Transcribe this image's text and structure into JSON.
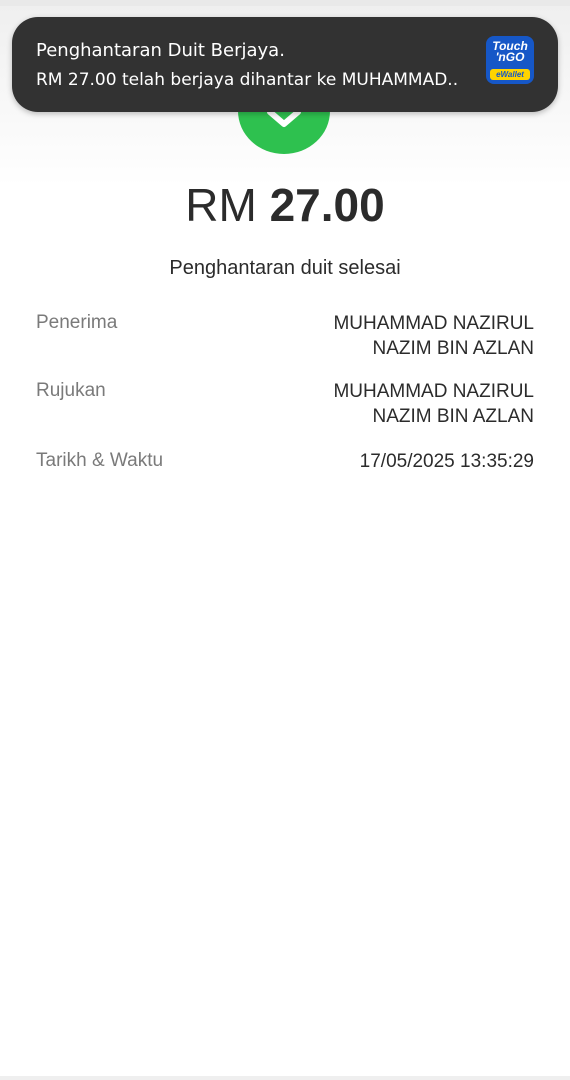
{
  "notification": {
    "title": "Penghantaran Duit Berjaya.",
    "body": "RM 27.00 telah berjaya dihantar ke MUHAMMAD..",
    "app_logo_top_line1": "Touch",
    "app_logo_top_line2": "'nGO",
    "app_logo_bottom": "eWallet"
  },
  "receipt": {
    "currency": "RM",
    "amount": "27.00",
    "status": "Penghantaran duit selesai",
    "rows": [
      {
        "label": "Penerima",
        "value_line1": "MUHAMMAD NAZIRUL",
        "value_line2": "NAZIM BIN AZLAN"
      },
      {
        "label": "Rujukan",
        "value_line1": "MUHAMMAD NAZIRUL",
        "value_line2": "NAZIM BIN AZLAN"
      },
      {
        "label": "Tarikh & Waktu",
        "value_line1": "17/05/2025 13:35:29"
      }
    ]
  },
  "colors": {
    "success_green": "#2ec14f",
    "notification_bg": "#323232",
    "app_icon_blue": "#1657c7",
    "app_icon_yellow": "#ffd400"
  },
  "icons": {
    "success": "check-icon",
    "app": "touch-n-go-ewallet-icon"
  }
}
